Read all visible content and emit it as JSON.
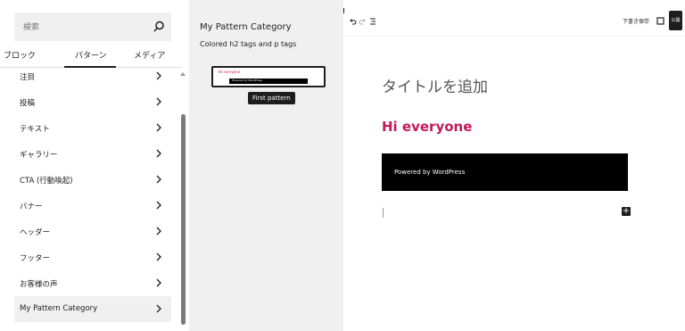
{
  "inserter": {
    "search_placeholder": "検索",
    "tabs": [
      "ブロック",
      "パターン",
      "メディア"
    ],
    "categories": [
      {
        "label": "注目"
      },
      {
        "label": "投稿"
      },
      {
        "label": "テキスト"
      },
      {
        "label": "ギャラリー"
      },
      {
        "label": "CTA (行動喚起)"
      },
      {
        "label": "バナー"
      },
      {
        "label": "ヘッダー"
      },
      {
        "label": "フッター"
      },
      {
        "label": "お客様の声"
      },
      {
        "label": "My Pattern Category"
      }
    ],
    "selected_category": "My Pattern Category",
    "icons": {
      "search": "search-icon",
      "chevron": "chevron-right-icon"
    }
  },
  "pattern_panel": {
    "title": "My Pattern Category",
    "description": "Colored h2 tags and p tags",
    "preview": {
      "heading": "Hi everyone",
      "footer": "Powered by WordPress"
    },
    "tooltip": "First pattern"
  },
  "editor": {
    "toolbar": {
      "save_draft": "下書き保存",
      "publish": "公開",
      "icons": [
        "undo-icon",
        "redo-icon",
        "list-view-icon",
        "preview-icon"
      ]
    },
    "post_title_placeholder": "タイトルを追加",
    "heading": "Hi everyone",
    "footer_text": "Powered by WordPress",
    "accent_color": "#c2185b"
  }
}
